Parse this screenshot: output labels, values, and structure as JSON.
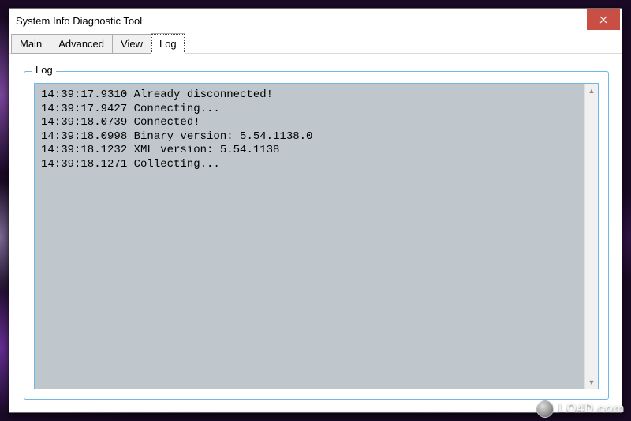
{
  "window": {
    "title": "System Info Diagnostic Tool"
  },
  "tabs": [
    {
      "label": "Main",
      "active": false
    },
    {
      "label": "Advanced",
      "active": false
    },
    {
      "label": "View",
      "active": false
    },
    {
      "label": "Log",
      "active": true
    }
  ],
  "groupbox": {
    "legend": "Log"
  },
  "log_lines": [
    "14:39:17.9310 Already disconnected!",
    "14:39:17.9427 Connecting...",
    "14:39:18.0739 Connected!",
    "14:39:18.0998 Binary version: 5.54.1138.0",
    "14:39:18.1232 XML version: 5.54.1138",
    "14:39:18.1271 Collecting..."
  ],
  "watermark": {
    "text": "LO4D.com"
  },
  "icons": {
    "close": "close-icon",
    "scroll_up": "▲",
    "scroll_down": "▼"
  }
}
